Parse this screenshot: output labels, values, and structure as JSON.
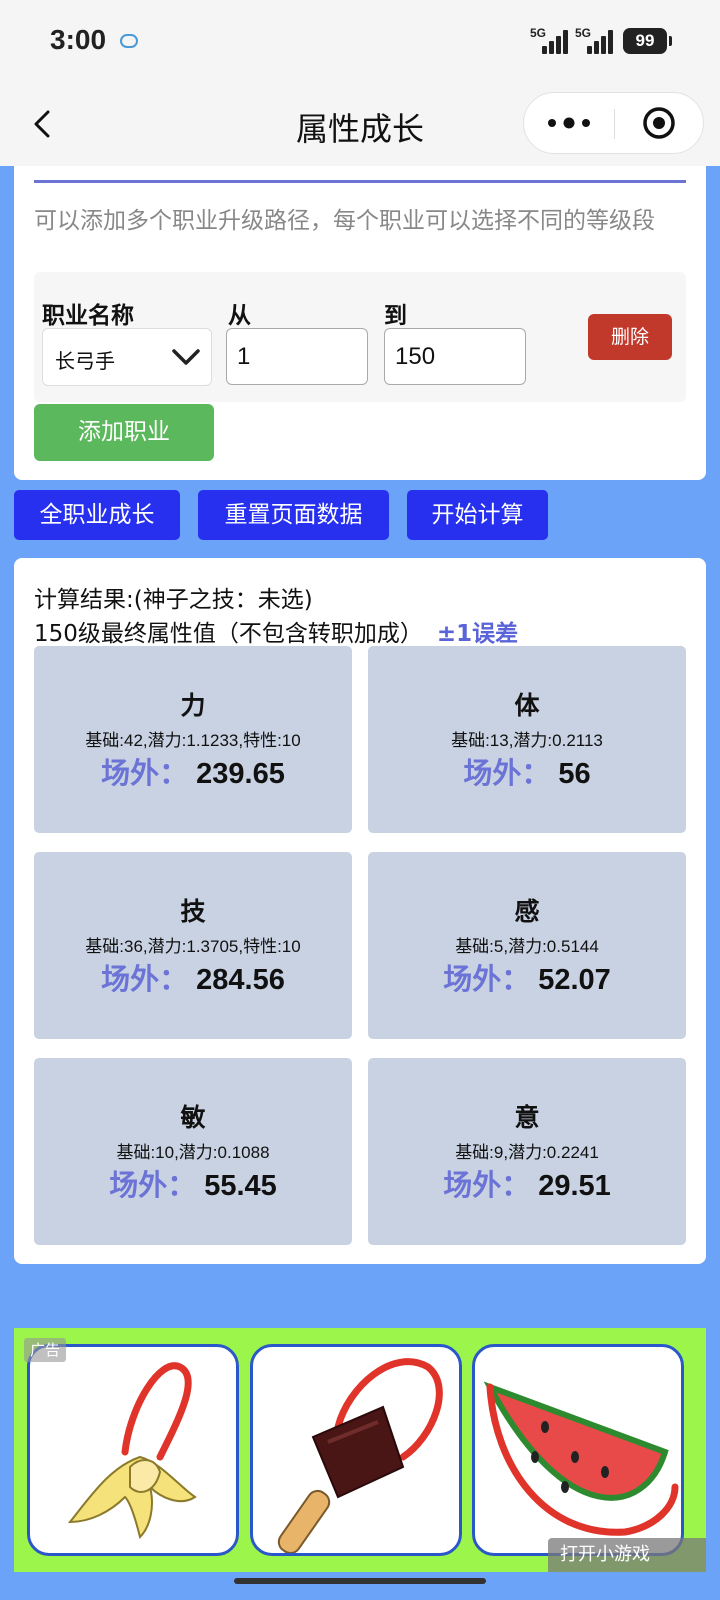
{
  "status_bar": {
    "time": "3:00",
    "network_1": "5G",
    "network_2": "5G",
    "battery": "99"
  },
  "nav": {
    "title": "属性成长"
  },
  "form": {
    "hint": "可以添加多个职业升级路径，每个职业可以选择不同的等级段",
    "class_label": "职业名称",
    "from_label": "从",
    "to_label": "到",
    "class_value": "长弓手",
    "from_value": "1",
    "to_value": "150",
    "delete_label": "删除",
    "add_label": "添加职业"
  },
  "actions": {
    "all_growth": "全职业成长",
    "reset": "重置页面数据",
    "calculate": "开始计算"
  },
  "result": {
    "title": "计算结果:(神子之技：未选)",
    "subtitle": "150级最终属性值（不包含转职加成）",
    "error": "±1误差",
    "value_label": "场外：",
    "stats": [
      {
        "name": "力",
        "detail": "基础:42,潜力:1.1233,特性:10",
        "value": "239.65"
      },
      {
        "name": "体",
        "detail": "基础:13,潜力:0.2113",
        "value": "56"
      },
      {
        "name": "技",
        "detail": "基础:36,潜力:1.3705,特性:10",
        "value": "284.56"
      },
      {
        "name": "感",
        "detail": "基础:5,潜力:0.5144",
        "value": "52.07"
      },
      {
        "name": "敏",
        "detail": "基础:10,潜力:0.1088",
        "value": "55.45"
      },
      {
        "name": "意",
        "detail": "基础:9,潜力:0.2241",
        "value": "29.51"
      }
    ]
  },
  "ad": {
    "tag": "广告",
    "open_label": "打开小游戏"
  },
  "colors": {
    "page_bg": "#6aa3f8",
    "accent_blue": "#2630ee",
    "purple": "#6b74d6",
    "green": "#5cb85c",
    "red": "#c0392b",
    "stat_bg": "#c9d2e2",
    "ad_bg": "#9cf54a"
  }
}
